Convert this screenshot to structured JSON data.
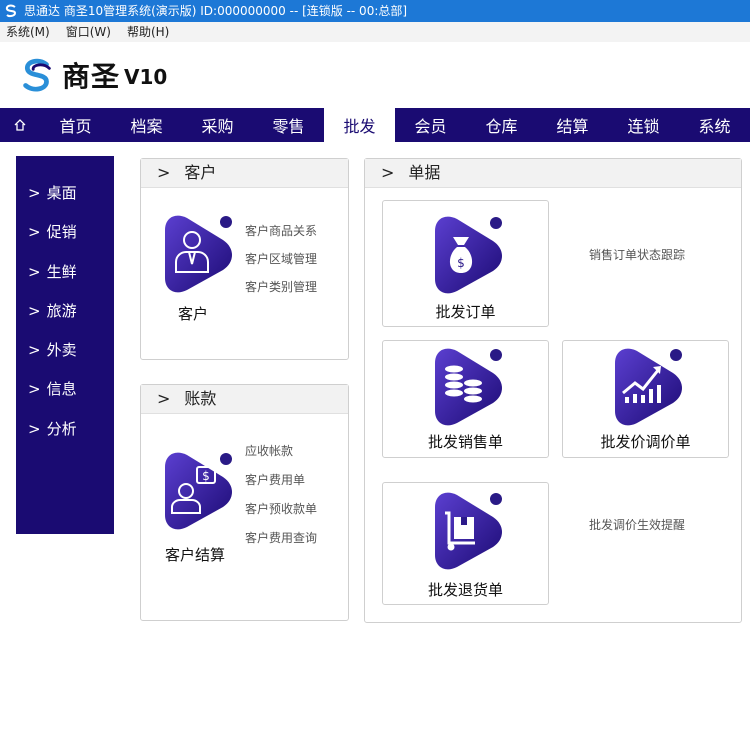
{
  "window": {
    "title": "思通达 商圣10管理系统(演示版) ID:000000000 -- [连锁版 -- 00:总部]"
  },
  "menubar": {
    "items": [
      "系统(M)",
      "窗口(W)",
      "帮助(H)"
    ]
  },
  "logo": {
    "name": "商圣",
    "version": "V10"
  },
  "nav": {
    "tabs": [
      "首页",
      "档案",
      "采购",
      "零售",
      "批发",
      "会员",
      "仓库",
      "结算",
      "连锁",
      "系统"
    ],
    "active": "批发"
  },
  "sidebar": {
    "items": [
      "桌面",
      "促销",
      "生鲜",
      "旅游",
      "外卖",
      "信息",
      "分析"
    ]
  },
  "customer_panel": {
    "title": "客户",
    "icon_label": "客户",
    "links": [
      "客户商品关系",
      "客户区域管理",
      "客户类别管理"
    ]
  },
  "account_panel": {
    "title": "账款",
    "icon_label": "客户结算",
    "links": [
      "应收帐款",
      "客户费用单",
      "客户预收款单",
      "客户费用查询"
    ]
  },
  "doc_panel": {
    "title": "单据",
    "cards": [
      "批发订单",
      "批发销售单",
      "批发价调价单",
      "批发退货单"
    ],
    "notes": [
      "销售订单状态跟踪",
      "批发调价生效提醒"
    ]
  },
  "colors": {
    "brand": "#1a0b72",
    "titlebar": "#1d78d6",
    "icon_dark": "#2c1a8a",
    "icon_light": "#5b3fd0"
  }
}
